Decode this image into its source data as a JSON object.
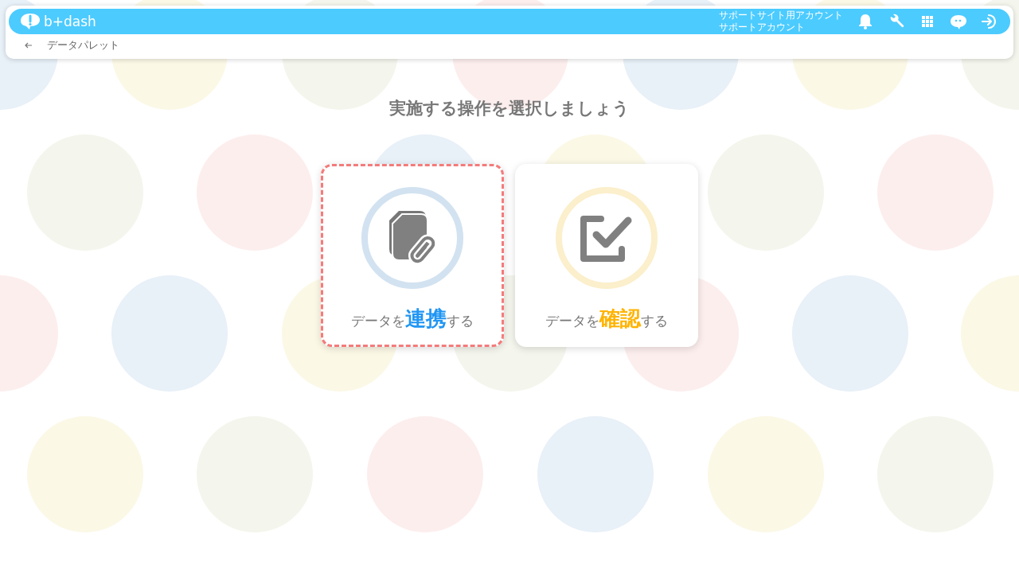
{
  "header": {
    "logo": "b+dash",
    "account": {
      "site": "サポートサイト用アカウント",
      "user": "サポートアカウント"
    }
  },
  "breadcrumb": {
    "title": "データパレット"
  },
  "heading": "実施する操作を選択しましょう",
  "cards": [
    {
      "kind": "link",
      "prefix": "データを",
      "emphasis": "連携",
      "suffix": "する",
      "color": "#2196f3",
      "selected": true
    },
    {
      "kind": "check",
      "prefix": "データを",
      "emphasis": "確認",
      "suffix": "する",
      "color": "#ffb300",
      "selected": false
    }
  ]
}
